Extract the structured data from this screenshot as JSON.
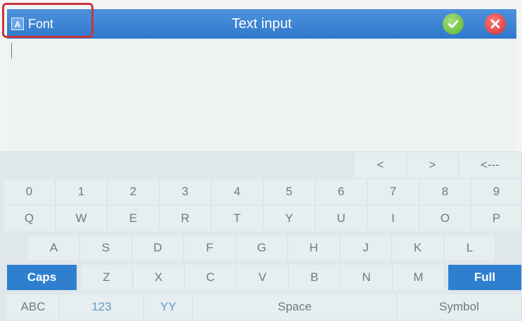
{
  "titlebar": {
    "font_label": "Font",
    "font_icon_glyph": "A",
    "title": "Text  input",
    "ok_icon": "check-icon",
    "close_icon": "close-icon",
    "colors": {
      "bar": "#2f78cc",
      "ok": "#5cb031",
      "close": "#d62c2c",
      "highlight": "#c9353b"
    }
  },
  "text_area": {
    "value": ""
  },
  "keyboard": {
    "nav_row": [
      "<",
      ">",
      "<---"
    ],
    "number_row": [
      "0",
      "1",
      "2",
      "3",
      "4",
      "5",
      "6",
      "7",
      "8",
      "9"
    ],
    "qwerty_row": [
      "Q",
      "W",
      "E",
      "R",
      "T",
      "Y",
      "U",
      "I",
      "O",
      "P"
    ],
    "asdf_row": [
      "A",
      "S",
      "D",
      "F",
      "G",
      "H",
      "J",
      "K",
      "L"
    ],
    "zxcv_row": [
      "Caps",
      "Z",
      "X",
      "C",
      "V",
      "B",
      "N",
      "M",
      "Full"
    ],
    "bottom_row": [
      "ABC",
      "123",
      "YY",
      "Space",
      "Symbol"
    ]
  }
}
